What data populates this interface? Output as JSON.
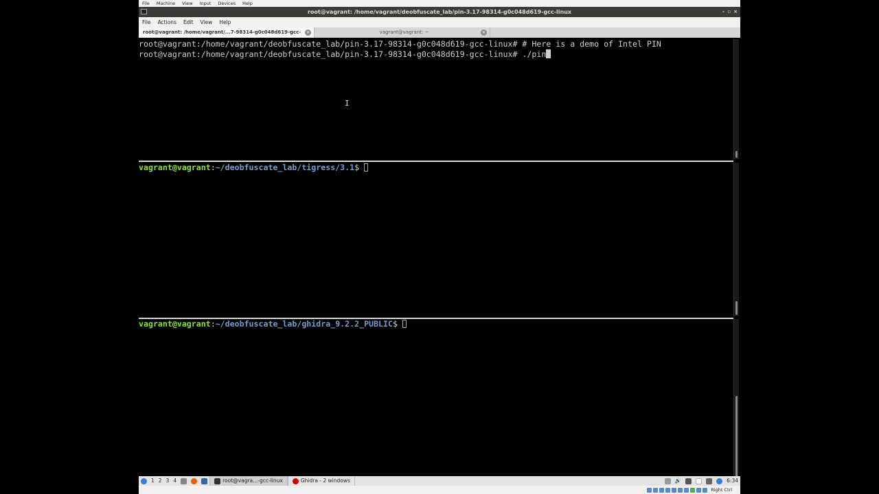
{
  "host_menu": [
    "File",
    "Machine",
    "View",
    "Input",
    "Devices",
    "Help"
  ],
  "window": {
    "title": "root@vagrant: /home/vagrant/deobfuscate_lab/pin-3.17-98314-g0c048d619-gcc-linux",
    "minimize": "–",
    "maximize": "▫",
    "close": "×"
  },
  "terminal_menu": [
    "File",
    "Actions",
    "Edit",
    "View",
    "Help"
  ],
  "tabs": [
    {
      "label": "root@vagrant: /home/vagrant/...7-98314-g0c048d619-gcc-linux",
      "active": true
    },
    {
      "label": "vagrant@vagrant: ~",
      "active": false
    }
  ],
  "pane1": {
    "prompt": "root@vagrant:/home/vagrant/deobfuscate_lab/pin-3.17-98314-g0c048d619-gcc-linux#",
    "line1_cmd": " # Here is a demo of Intel PIN",
    "line2_cmd": " ./pin"
  },
  "pane2": {
    "user": "vagrant@vagrant",
    "sep": ":",
    "path": "~/deobfuscate_lab/tigress/3.1",
    "symbol": "$ "
  },
  "pane3": {
    "user": "vagrant@vagrant",
    "sep": ":",
    "path": "~/deobfuscate_lab/ghidra_9.2.2_PUBLIC",
    "symbol": "$ "
  },
  "taskbar": {
    "workspaces": [
      "1",
      "2",
      "3",
      "4"
    ],
    "tasks": [
      {
        "label": "root@vagra...-gcc-linux"
      },
      {
        "label": "Ghidra - 2 windows"
      }
    ],
    "clock": "6:34"
  },
  "statusbar": {
    "host_key": "Right Ctrl"
  },
  "colors": {
    "prompt_user": "#8ae234",
    "prompt_path": "#729fcf",
    "terminal_bg": "#000000",
    "terminal_fg": "#d0d0d0"
  }
}
